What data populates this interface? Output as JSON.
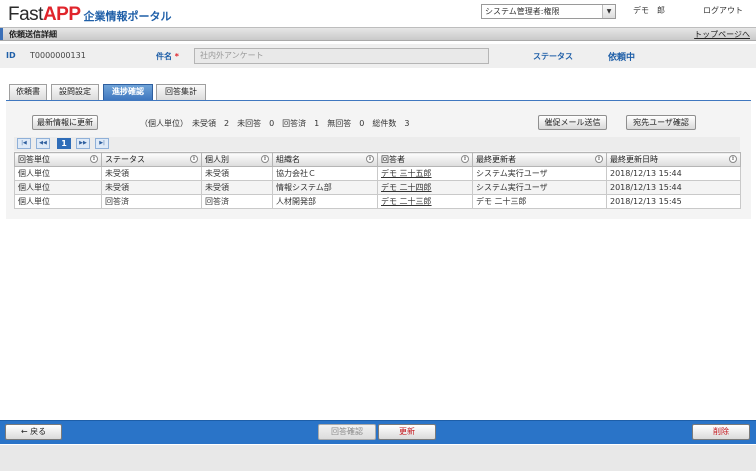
{
  "header": {
    "logo_fast": "Fast",
    "logo_app": "APP",
    "logo_sub": "企業情報ポータル",
    "role_select_value": "システム管理者:権限",
    "user_name": "デモ　郎",
    "logout": "ログアウト",
    "page_title": "依頼送信詳細",
    "top_page_link": "トップページへ"
  },
  "info": {
    "id_label": "ID",
    "id_value": "T0000000131",
    "name_label": "件名",
    "required_mark": "*",
    "name_value": "社内外アンケート",
    "status_label": "ステータス",
    "status_value": "依頼中"
  },
  "tabs": [
    {
      "label": "依頼書",
      "active": false
    },
    {
      "label": "設問設定",
      "active": false
    },
    {
      "label": "進捗確認",
      "active": true
    },
    {
      "label": "回答集計",
      "active": false
    }
  ],
  "toolbar": {
    "refresh_label": "最新情報に更新",
    "summary": "（個人単位）　未受領　2　未回答　0　回答済　1　無回答　0　総件数　3",
    "reminder_label": "催促メール送信",
    "recipient_label": "宛先ユーザ確認"
  },
  "pager": {
    "first": "|◀",
    "prev": "◀◀",
    "current": "1",
    "next": "▶▶",
    "last": "▶|"
  },
  "table": {
    "columns": [
      "回答単位",
      "ステータス",
      "個人別",
      "組織名",
      "回答者",
      "最終更新者",
      "最終更新日時"
    ],
    "sort_icon": "⇕",
    "rows": [
      [
        "個人単位",
        "未受領",
        "未受領",
        "協力会社Ｃ",
        "デモ 三十五郎",
        "システム実行ユーザ",
        "2018/12/13 15:44"
      ],
      [
        "個人単位",
        "未受領",
        "未受領",
        "情報システム部",
        "デモ 二十四郎",
        "システム実行ユーザ",
        "2018/12/13 15:44"
      ],
      [
        "個人単位",
        "回答済",
        "回答済",
        "人材開発部",
        "デモ 二十三郎",
        "デモ 二十三郎",
        "2018/12/13 15:45"
      ]
    ]
  },
  "footer": {
    "back_label": "← 戻る",
    "answer_disabled_label": "回答確認",
    "update_label": "更新",
    "delete_label": "削除"
  }
}
